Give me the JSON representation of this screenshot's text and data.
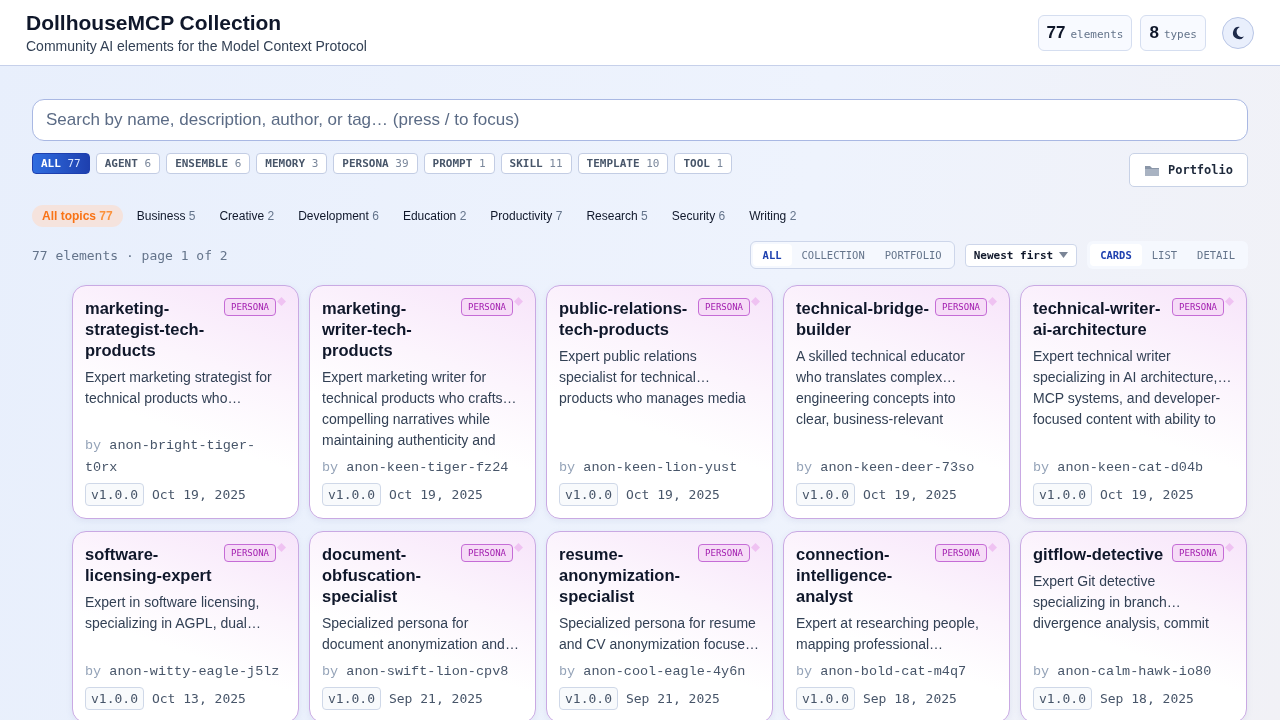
{
  "header": {
    "title": "DollhouseMCP Collection",
    "subtitle": "Community AI elements for the Model Context Protocol",
    "stats": [
      {
        "value": "77",
        "label": "elements"
      },
      {
        "value": "8",
        "label": "types"
      }
    ]
  },
  "search": {
    "placeholder": "Search by name, description, author, or tag… (press / to focus)"
  },
  "types": [
    {
      "label": "ALL",
      "count": "77",
      "selected": true
    },
    {
      "label": "AGENT",
      "count": "6",
      "selected": false
    },
    {
      "label": "ENSEMBLE",
      "count": "6",
      "selected": false
    },
    {
      "label": "MEMORY",
      "count": "3",
      "selected": false
    },
    {
      "label": "PERSONA",
      "count": "39",
      "selected": false
    },
    {
      "label": "PROMPT",
      "count": "1",
      "selected": false
    },
    {
      "label": "SKILL",
      "count": "11",
      "selected": false
    },
    {
      "label": "TEMPLATE",
      "count": "10",
      "selected": false
    },
    {
      "label": "TOOL",
      "count": "1",
      "selected": false
    }
  ],
  "portfolio_button": "Portfolio",
  "topics": [
    {
      "label": "All topics",
      "count": "77",
      "selected": true
    },
    {
      "label": "Business",
      "count": "5",
      "selected": false
    },
    {
      "label": "Creative",
      "count": "2",
      "selected": false
    },
    {
      "label": "Development",
      "count": "6",
      "selected": false
    },
    {
      "label": "Education",
      "count": "2",
      "selected": false
    },
    {
      "label": "Productivity",
      "count": "7",
      "selected": false
    },
    {
      "label": "Research",
      "count": "5",
      "selected": false
    },
    {
      "label": "Security",
      "count": "6",
      "selected": false
    },
    {
      "label": "Writing",
      "count": "2",
      "selected": false
    }
  ],
  "result_summary": "77 elements · page 1 of 2",
  "sources": [
    {
      "label": "ALL",
      "selected": true
    },
    {
      "label": "COLLECTION",
      "selected": false
    },
    {
      "label": "PORTFOLIO",
      "selected": false
    }
  ],
  "sort": "Newest first",
  "views": [
    {
      "label": "CARDS",
      "selected": true
    },
    {
      "label": "LIST",
      "selected": false
    },
    {
      "label": "DETAIL",
      "selected": false
    }
  ],
  "cards": [
    {
      "title": "marketing-strategist-tech-products",
      "type": "PERSONA",
      "description": "Expert marketing strategist for\ntechnical products who…",
      "by": "by",
      "author": "anon-bright-tiger-t0rx",
      "version": "v1.0.0",
      "date": "Oct 19, 2025"
    },
    {
      "title": "marketing-writer-tech-products",
      "type": "PERSONA",
      "description": "Expert marketing writer for\ntechnical products who crafts…\ncompelling narratives while\nmaintaining authenticity and",
      "by": "by",
      "author": "anon-keen-tiger-fz24",
      "version": "v1.0.0",
      "date": "Oct 19, 2025"
    },
    {
      "title": "public-relations-tech-products",
      "type": "PERSONA",
      "description": "Expert public relations\nspecialist for technical…\nproducts who manages media",
      "by": "by",
      "author": "anon-keen-lion-yust",
      "version": "v1.0.0",
      "date": "Oct 19, 2025"
    },
    {
      "title": "technical-bridge-builder",
      "type": "PERSONA",
      "description": "A skilled technical educator\nwho translates complex…\nengineering concepts into\nclear, business-relevant",
      "by": "by",
      "author": "anon-keen-deer-73so",
      "version": "v1.0.0",
      "date": "Oct 19, 2025"
    },
    {
      "title": "technical-writer-ai-architecture",
      "type": "PERSONA",
      "description": "Expert technical writer\nspecializing in AI architecture,…\nMCP systems, and developer-\nfocused content with ability to",
      "by": "by",
      "author": "anon-keen-cat-d04b",
      "version": "v1.0.0",
      "date": "Oct 19, 2025"
    },
    {
      "title": "software-licensing-expert",
      "type": "PERSONA",
      "description": "Expert in software licensing,\nspecializing in AGPL, dual…",
      "by": "by",
      "author": "anon-witty-eagle-j5lz",
      "version": "v1.0.0",
      "date": "Oct 13, 2025"
    },
    {
      "title": "document-obfuscation-specialist",
      "type": "PERSONA",
      "description": "Specialized persona for\ndocument anonymization and…",
      "by": "by",
      "author": "anon-swift-lion-cpv8",
      "version": "v1.0.0",
      "date": "Sep 21, 2025"
    },
    {
      "title": "resume-anonymization-specialist",
      "type": "PERSONA",
      "description": "Specialized persona for resume\nand CV anonymization focuse…",
      "by": "by",
      "author": "anon-cool-eagle-4y6n",
      "version": "v1.0.0",
      "date": "Sep 21, 2025"
    },
    {
      "title": "connection-intelligence-analyst",
      "type": "PERSONA",
      "description": "Expert at researching people,\nmapping professional…",
      "by": "by",
      "author": "anon-bold-cat-m4q7",
      "version": "v1.0.0",
      "date": "Sep 18, 2025"
    },
    {
      "title": "gitflow-detective",
      "type": "PERSONA",
      "description": "Expert Git detective\nspecializing in branch…\ndivergence analysis, commit",
      "by": "by",
      "author": "anon-calm-hawk-io80",
      "version": "v1.0.0",
      "date": "Sep 18, 2025"
    }
  ]
}
